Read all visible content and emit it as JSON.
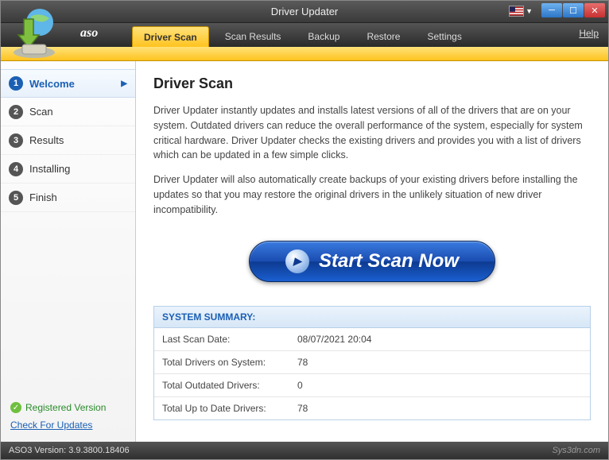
{
  "window": {
    "title": "Driver Updater",
    "brand": "aso",
    "help": "Help"
  },
  "tabs": [
    {
      "label": "Driver Scan"
    },
    {
      "label": "Scan Results"
    },
    {
      "label": "Backup"
    },
    {
      "label": "Restore"
    },
    {
      "label": "Settings"
    }
  ],
  "steps": [
    {
      "num": "1",
      "label": "Welcome"
    },
    {
      "num": "2",
      "label": "Scan"
    },
    {
      "num": "3",
      "label": "Results"
    },
    {
      "num": "4",
      "label": "Installing"
    },
    {
      "num": "5",
      "label": "Finish"
    }
  ],
  "sidebar_footer": {
    "registered": "Registered Version",
    "check_updates": "Check For Updates"
  },
  "main": {
    "heading": "Driver Scan",
    "para1": "Driver Updater instantly updates and installs latest versions of all of the drivers that are on your system. Outdated drivers can reduce the overall performance of the system, especially for system critical hardware. Driver Updater checks the existing drivers and provides you with a list of drivers which can be updated in a few simple clicks.",
    "para2": "Driver Updater will also automatically create backups of your existing drivers before installing the updates so that you may restore the original drivers in the unlikely situation of new driver incompatibility.",
    "scan_button": "Start Scan Now"
  },
  "summary": {
    "title": "SYSTEM SUMMARY:",
    "rows": [
      {
        "label": "Last Scan Date:",
        "value": "08/07/2021 20:04"
      },
      {
        "label": "Total Drivers on System:",
        "value": "78"
      },
      {
        "label": "Total Outdated Drivers:",
        "value": "0"
      },
      {
        "label": "Total Up to Date Drivers:",
        "value": "78"
      }
    ]
  },
  "statusbar": {
    "version": "ASO3 Version: 3.9.3800.18406",
    "watermark": "Sys3dn.com"
  }
}
